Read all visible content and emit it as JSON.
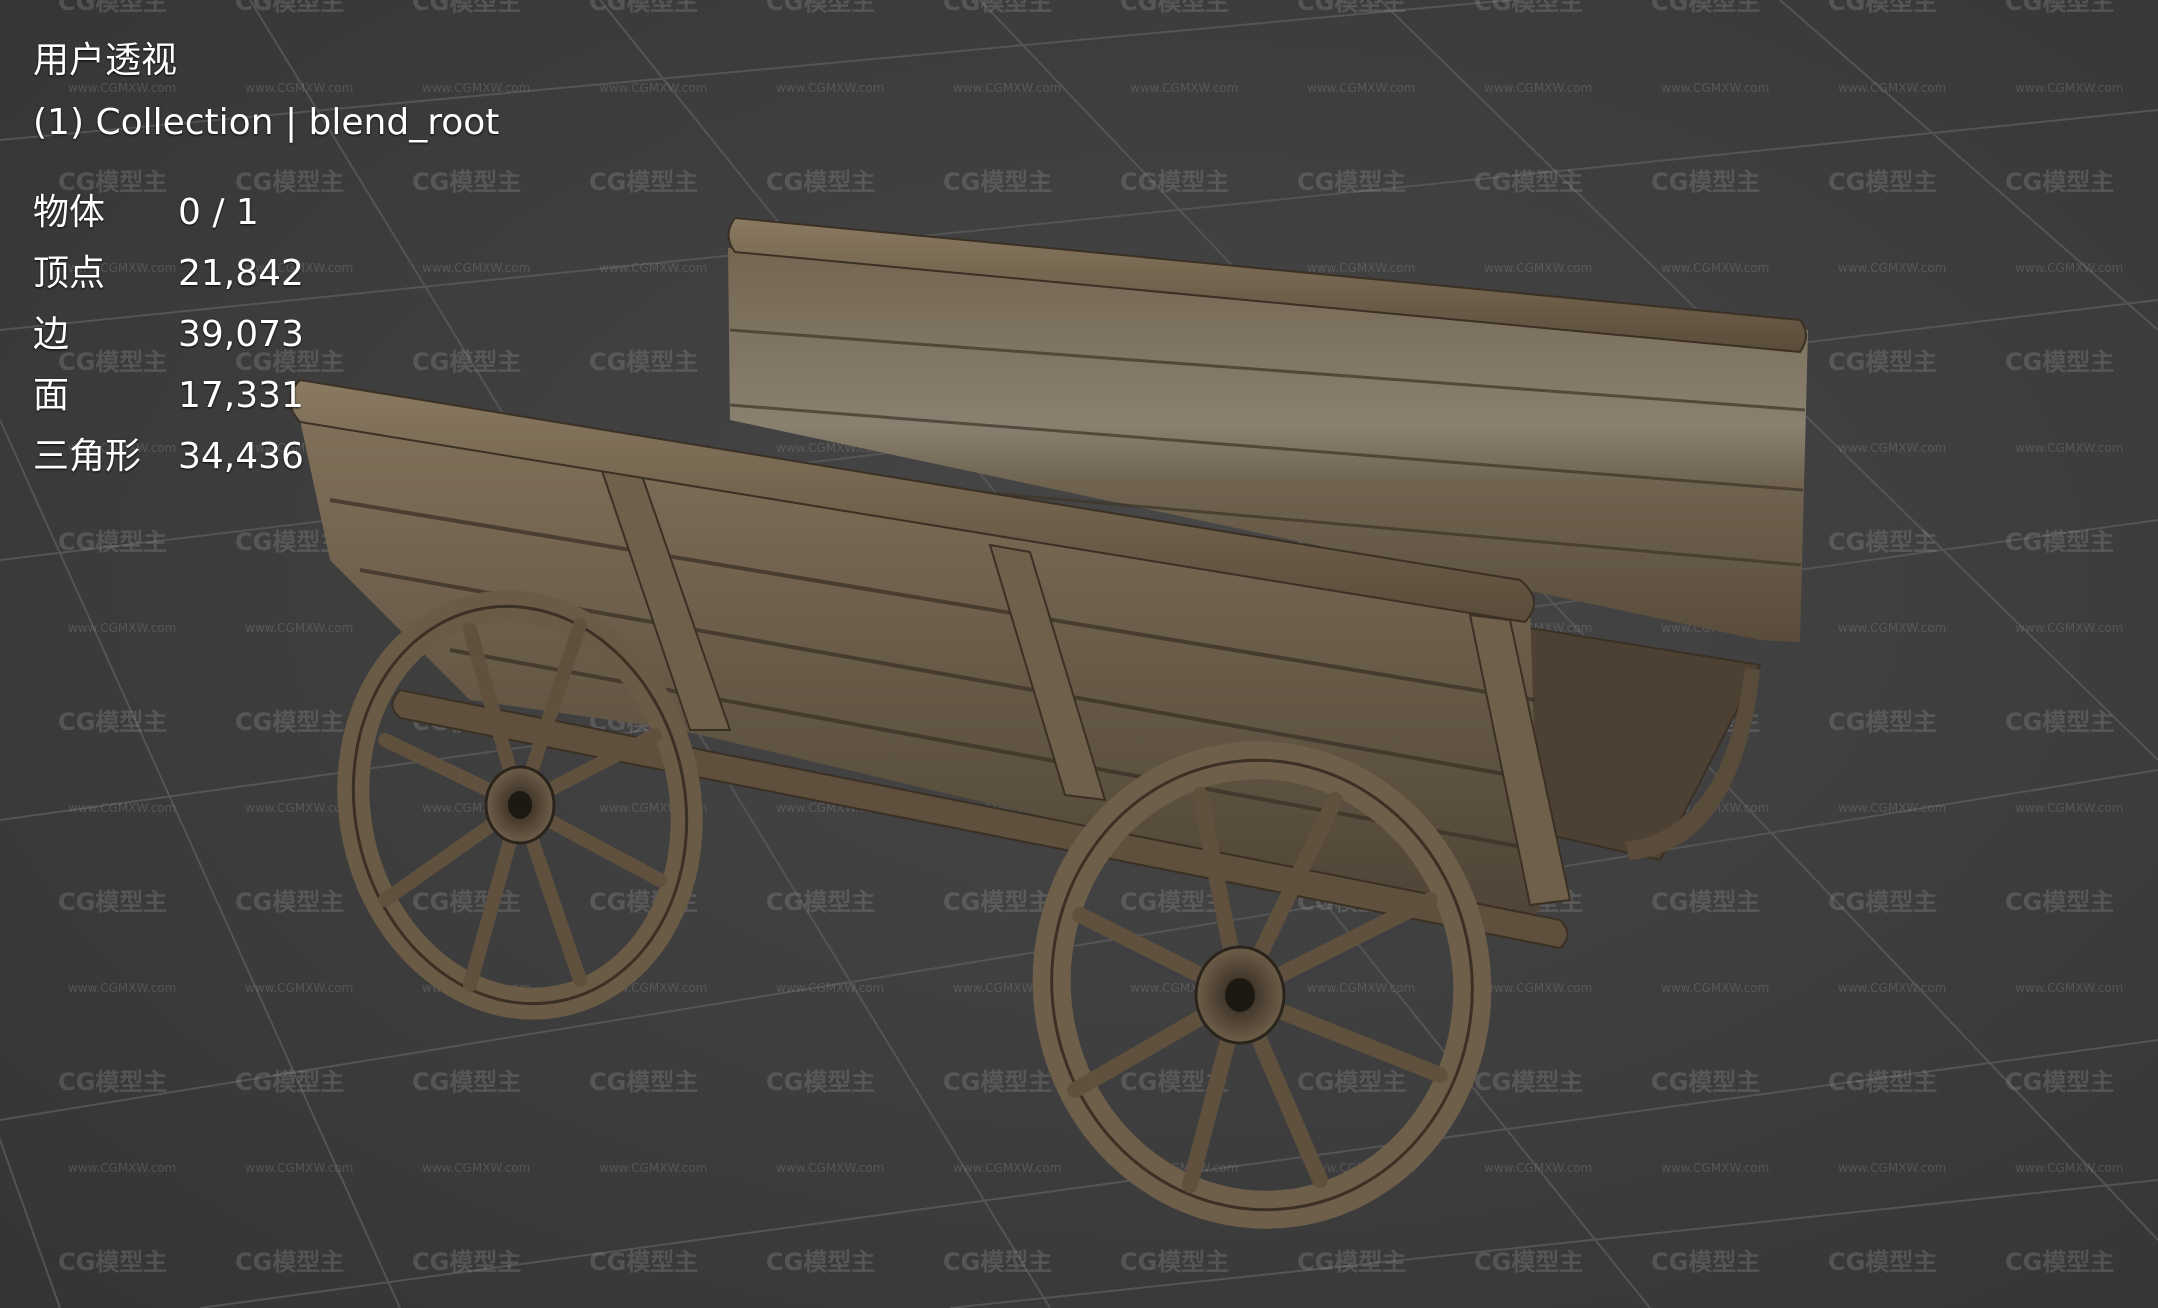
{
  "viewport": {
    "view_name": "用户透视",
    "collection_line": "(1) Collection | blend_root",
    "stats": [
      {
        "label": "物体",
        "value": "0 / 1"
      },
      {
        "label": "顶点",
        "value": "21,842"
      },
      {
        "label": "边",
        "value": "39,073"
      },
      {
        "label": "面",
        "value": "17,331"
      },
      {
        "label": "三角形",
        "value": "34,436"
      }
    ]
  },
  "watermark": {
    "logo_text": "CG模型主",
    "url_text": "www.CGMXW.com"
  },
  "colors": {
    "background": "#3c3c3c",
    "grid_line": "#555555",
    "wood_light": "#7a6a52",
    "wood_dark": "#4a3e2e",
    "text": "#ffffff"
  }
}
